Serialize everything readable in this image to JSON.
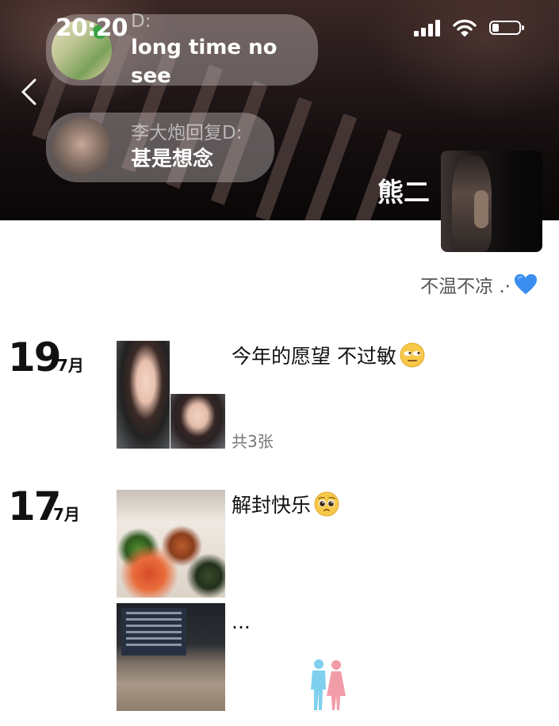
{
  "status_bar": {
    "time": "20:20",
    "signal_icon": "signal-bars-icon",
    "wifi_icon": "wifi-icon",
    "battery_icon": "battery-icon",
    "battery_level": 0.25
  },
  "header": {
    "back_icon": "chevron-left-icon",
    "nickname": "熊二",
    "signature": "不温不凉 .·",
    "signature_emoji": "blue-heart-icon",
    "bubbles": [
      {
        "from": "D:",
        "message": "long time no see"
      },
      {
        "from": "李大炮回复D:",
        "message": "甚是想念"
      }
    ]
  },
  "feed": [
    {
      "day": "19",
      "month": "7月",
      "caption": "今年的愿望 不过敏",
      "caption_emoji": "unamused-face-icon",
      "photo_count": "共3张"
    },
    {
      "day": "17",
      "month": "7月",
      "caption": "解封快乐",
      "caption_emoji": "pleading-face-icon",
      "photo_count": ""
    },
    {
      "day": "",
      "month": "",
      "caption": "...",
      "caption_emoji": "",
      "photo_count": ""
    }
  ],
  "colors": {
    "accent_blue_heart": "#3b8ef0",
    "watermark_blue": "#7fd0ee",
    "watermark_pink": "#f29ca8"
  }
}
